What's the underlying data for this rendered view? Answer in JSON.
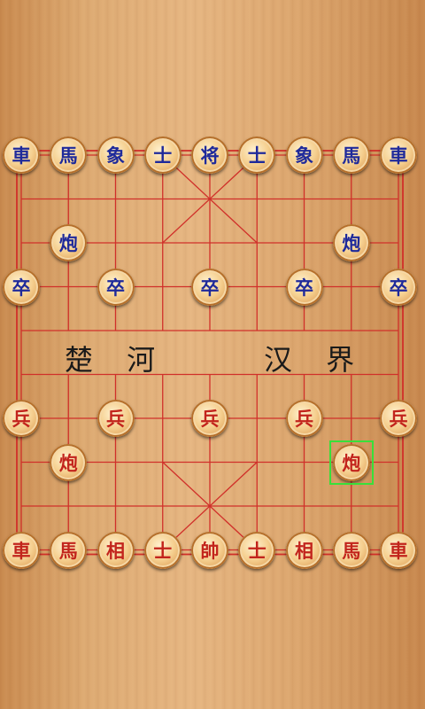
{
  "board": {
    "river_left": "楚 河",
    "river_right": "汉 界",
    "line_color": "#d0302a"
  },
  "pieces": [
    {
      "id": "b-chariot-l",
      "label": "車",
      "side": "black",
      "file": 0,
      "rank": 0
    },
    {
      "id": "b-horse-l",
      "label": "馬",
      "side": "black",
      "file": 1,
      "rank": 0
    },
    {
      "id": "b-elephant-l",
      "label": "象",
      "side": "black",
      "file": 2,
      "rank": 0
    },
    {
      "id": "b-advisor-l",
      "label": "士",
      "side": "black",
      "file": 3,
      "rank": 0
    },
    {
      "id": "b-general",
      "label": "将",
      "side": "black",
      "file": 4,
      "rank": 0
    },
    {
      "id": "b-advisor-r",
      "label": "士",
      "side": "black",
      "file": 5,
      "rank": 0
    },
    {
      "id": "b-elephant-r",
      "label": "象",
      "side": "black",
      "file": 6,
      "rank": 0
    },
    {
      "id": "b-horse-r",
      "label": "馬",
      "side": "black",
      "file": 7,
      "rank": 0
    },
    {
      "id": "b-chariot-r",
      "label": "車",
      "side": "black",
      "file": 8,
      "rank": 0
    },
    {
      "id": "b-cannon-l",
      "label": "炮",
      "side": "black",
      "file": 1,
      "rank": 2
    },
    {
      "id": "b-cannon-r",
      "label": "炮",
      "side": "black",
      "file": 7,
      "rank": 2
    },
    {
      "id": "b-soldier-1",
      "label": "卒",
      "side": "black",
      "file": 0,
      "rank": 3
    },
    {
      "id": "b-soldier-2",
      "label": "卒",
      "side": "black",
      "file": 2,
      "rank": 3
    },
    {
      "id": "b-soldier-3",
      "label": "卒",
      "side": "black",
      "file": 4,
      "rank": 3
    },
    {
      "id": "b-soldier-4",
      "label": "卒",
      "side": "black",
      "file": 6,
      "rank": 3
    },
    {
      "id": "b-soldier-5",
      "label": "卒",
      "side": "black",
      "file": 8,
      "rank": 3
    },
    {
      "id": "r-soldier-1",
      "label": "兵",
      "side": "red",
      "file": 0,
      "rank": 6
    },
    {
      "id": "r-soldier-2",
      "label": "兵",
      "side": "red",
      "file": 2,
      "rank": 6
    },
    {
      "id": "r-soldier-3",
      "label": "兵",
      "side": "red",
      "file": 4,
      "rank": 6
    },
    {
      "id": "r-soldier-4",
      "label": "兵",
      "side": "red",
      "file": 6,
      "rank": 6
    },
    {
      "id": "r-soldier-5",
      "label": "兵",
      "side": "red",
      "file": 8,
      "rank": 6
    },
    {
      "id": "r-cannon-l",
      "label": "炮",
      "side": "red",
      "file": 1,
      "rank": 7
    },
    {
      "id": "r-cannon-r",
      "label": "炮",
      "side": "red",
      "file": 7,
      "rank": 7
    },
    {
      "id": "r-chariot-l",
      "label": "車",
      "side": "red",
      "file": 0,
      "rank": 9
    },
    {
      "id": "r-horse-l",
      "label": "馬",
      "side": "red",
      "file": 1,
      "rank": 9
    },
    {
      "id": "r-elephant-l",
      "label": "相",
      "side": "red",
      "file": 2,
      "rank": 9
    },
    {
      "id": "r-advisor-l",
      "label": "士",
      "side": "red",
      "file": 3,
      "rank": 9
    },
    {
      "id": "r-general",
      "label": "帥",
      "side": "red",
      "file": 4,
      "rank": 9
    },
    {
      "id": "r-advisor-r",
      "label": "士",
      "side": "red",
      "file": 5,
      "rank": 9
    },
    {
      "id": "r-elephant-r",
      "label": "相",
      "side": "red",
      "file": 6,
      "rank": 9
    },
    {
      "id": "r-horse-r",
      "label": "馬",
      "side": "red",
      "file": 7,
      "rank": 9
    },
    {
      "id": "r-chariot-r",
      "label": "車",
      "side": "red",
      "file": 8,
      "rank": 9
    }
  ],
  "selected": {
    "file": 7,
    "rank": 7
  }
}
